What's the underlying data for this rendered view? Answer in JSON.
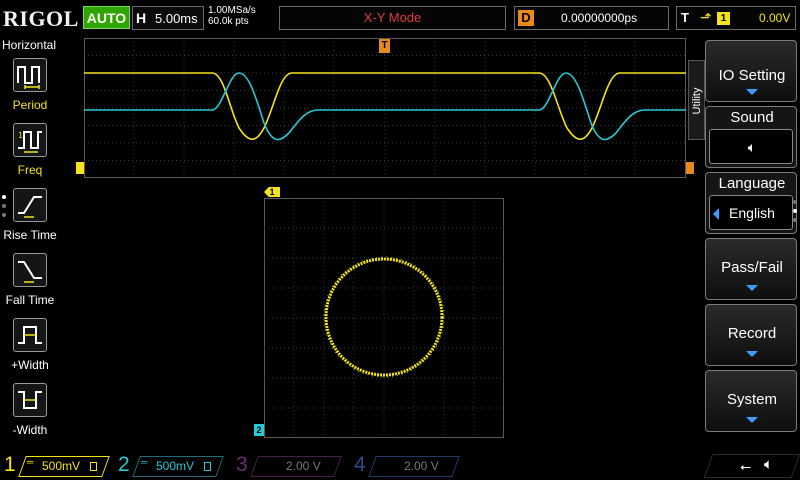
{
  "brand": "RIGOL",
  "run_mode": "AUTO",
  "horizontal": {
    "key": "H",
    "timebase": "5.00ms",
    "sample_rate": "1.00MSa/s",
    "memory_depth": "60.0k pts"
  },
  "display_mode": "X-Y Mode",
  "delay": {
    "key": "D",
    "value": "0.00000000ps"
  },
  "trigger": {
    "key": "T",
    "edge_icon": "rising-edge-icon",
    "source": "1",
    "level": "0.00V"
  },
  "left_menu": {
    "title": "Horizontal",
    "items": [
      {
        "label": "Period",
        "icon": "period-icon"
      },
      {
        "label": "Freq",
        "icon": "freq-icon"
      },
      {
        "label": "Rise Time",
        "icon": "rise-time-icon"
      },
      {
        "label": "Fall Time",
        "icon": "fall-time-icon"
      },
      {
        "label": "+Width",
        "icon": "positive-width-icon"
      },
      {
        "label": "-Width",
        "icon": "negative-width-icon"
      }
    ]
  },
  "markers": {
    "trigger_marker": "T",
    "ch1_marker": "1",
    "ch2_marker": "2"
  },
  "right_menu": {
    "tab": "Utility",
    "items": [
      {
        "label": "IO Setting"
      },
      {
        "label": "Sound",
        "value_icon": "speaker-icon"
      },
      {
        "label": "Language",
        "value": "English"
      },
      {
        "label": "Pass/Fail"
      },
      {
        "label": "Record"
      },
      {
        "label": "System"
      }
    ]
  },
  "channels": [
    {
      "number": "1",
      "coupling": "DC",
      "scale": "500mV",
      "color": "#f5e31a",
      "active": true
    },
    {
      "number": "2",
      "coupling": "DC",
      "scale": "500mV",
      "color": "#27c9d6",
      "active": true
    },
    {
      "number": "3",
      "scale": "2.00 V",
      "color": "#c23bbf",
      "active": false
    },
    {
      "number": "4",
      "scale": "2.00 V",
      "color": "#3d6fd6",
      "active": false
    }
  ],
  "status_icons": [
    "usb-icon",
    "speaker-icon"
  ],
  "colors": {
    "ch1": "#f5e31a",
    "ch2": "#27c9d6",
    "trigger_marker": "#e8891a",
    "auto_green": "#2fa600",
    "accent_blue": "#3d9cff"
  }
}
